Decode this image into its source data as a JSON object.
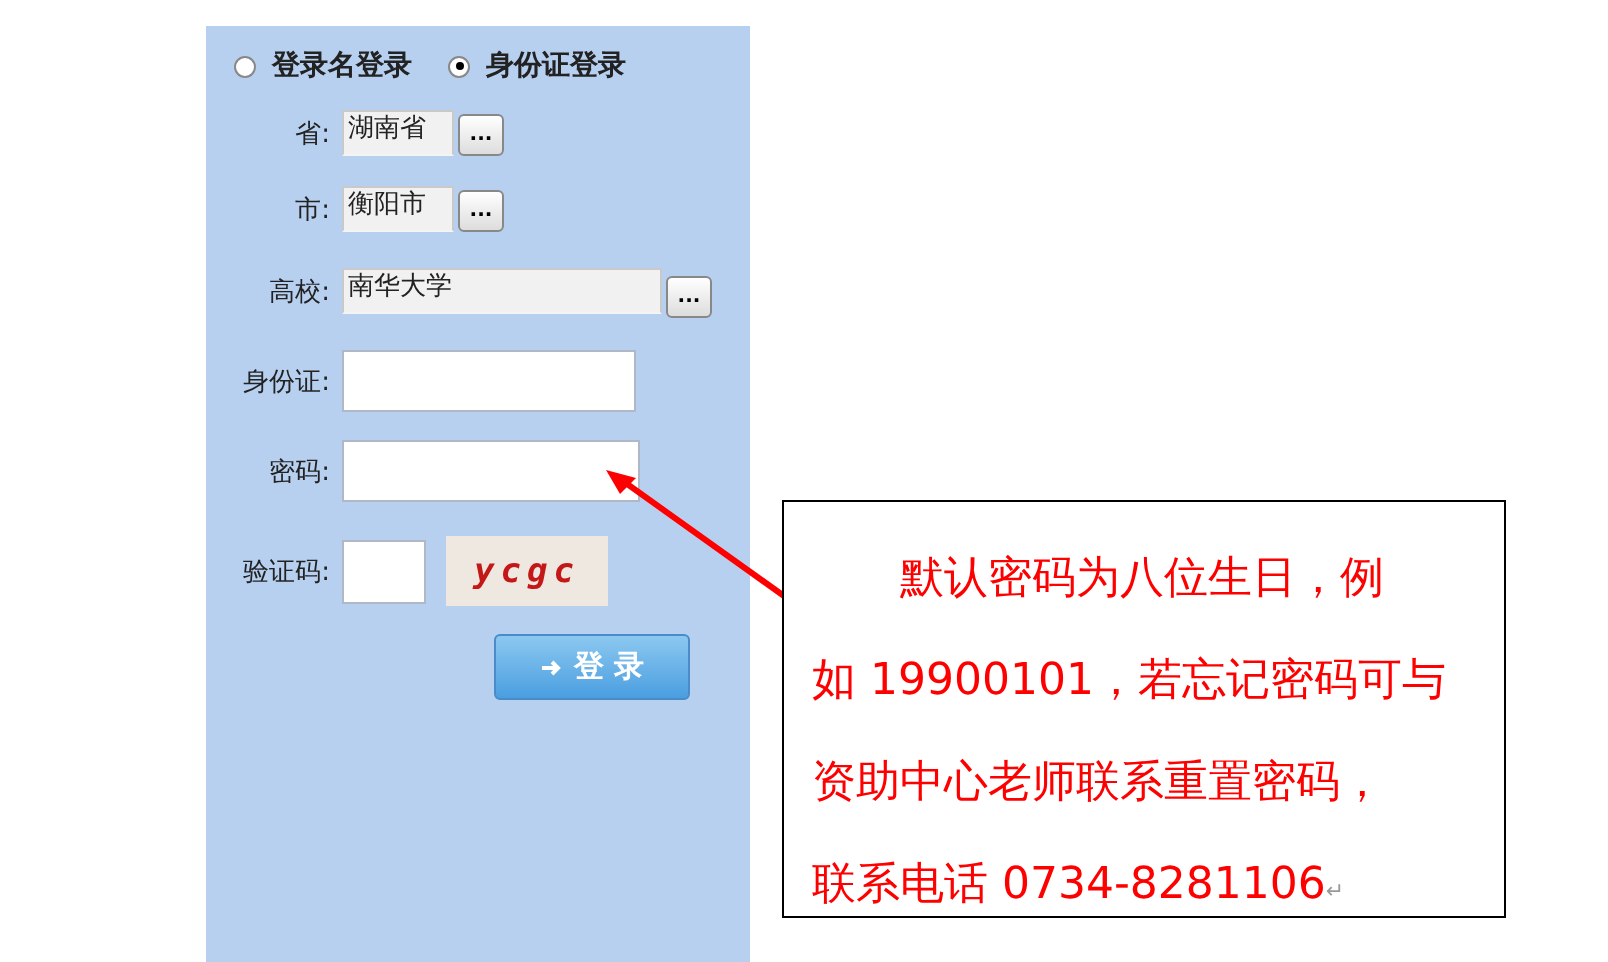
{
  "login_type": [
    {
      "label": "登录名登录",
      "selected": false
    },
    {
      "label": "身份证登录",
      "selected": true
    }
  ],
  "fields": [
    {
      "kind": "short-picker",
      "label": "省:",
      "value": "湖南省",
      "button": "..."
    },
    {
      "kind": "short-picker",
      "label": "市:",
      "value": "衡阳市",
      "button": "..."
    },
    {
      "kind": "long-picker",
      "label": "高校:",
      "value": "南华大学",
      "button": "..."
    },
    {
      "kind": "wide-input",
      "label": "身份证:"
    },
    {
      "kind": "wide-input",
      "label": "密码:"
    },
    {
      "kind": "captcha",
      "label": "验证码:",
      "captcha": "ycgc"
    }
  ],
  "login_button": "登 录",
  "note": {
    "lines": [
      "默认密码为八位生日，例",
      "如 19900101，若忘记密码可与",
      "资助中心老师联系重置密码，",
      "联系电话 0734-8281106"
    ],
    "mark": "↵"
  }
}
